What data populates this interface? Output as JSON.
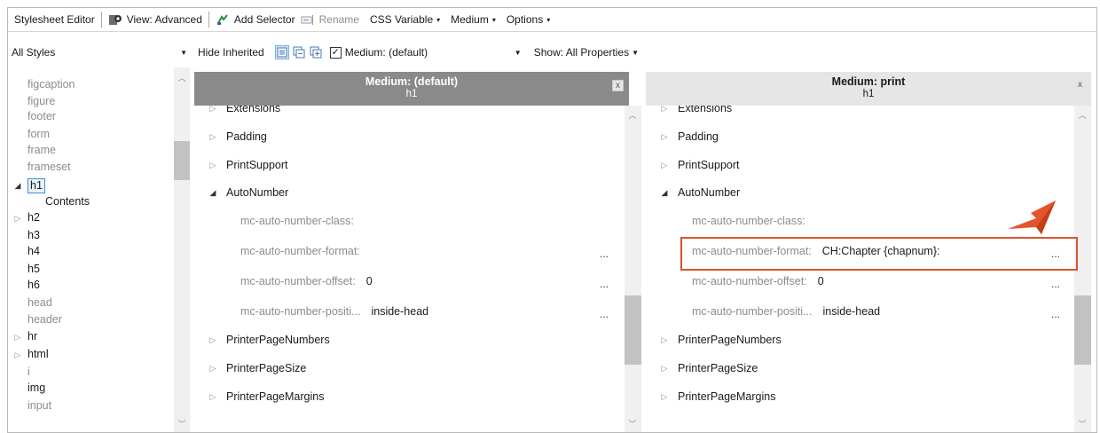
{
  "toolbar": {
    "title": "Stylesheet Editor",
    "view_label": "View: Advanced",
    "add_selector": "Add Selector",
    "rename": "Rename",
    "css_variable": "CSS Variable",
    "medium": "Medium",
    "options": "Options"
  },
  "filters": {
    "styles_combo": "All Styles",
    "hide_inherited": "Hide Inherited",
    "medium_check": "Medium: (default)",
    "show": "Show: All Properties"
  },
  "tree": {
    "items": [
      {
        "label": "figcaption",
        "expander": "",
        "state": "inherited"
      },
      {
        "label": "figure",
        "expander": "",
        "state": "inherited"
      },
      {
        "label": "footer",
        "expander": "",
        "state": "inherited"
      },
      {
        "label": "form",
        "expander": "",
        "state": "inherited"
      },
      {
        "label": "frame",
        "expander": "",
        "state": "inherited"
      },
      {
        "label": "frameset",
        "expander": "",
        "state": "inherited"
      },
      {
        "label": "h1",
        "expander": "◢",
        "state": "selected"
      },
      {
        "label": "Contents",
        "expander": "",
        "state": "child"
      },
      {
        "label": "h2",
        "expander": "▷",
        "state": "defined"
      },
      {
        "label": "h3",
        "expander": "",
        "state": "defined"
      },
      {
        "label": "h4",
        "expander": "",
        "state": "defined"
      },
      {
        "label": "h5",
        "expander": "",
        "state": "defined"
      },
      {
        "label": "h6",
        "expander": "",
        "state": "defined"
      },
      {
        "label": "head",
        "expander": "",
        "state": "inherited"
      },
      {
        "label": "header",
        "expander": "",
        "state": "inherited"
      },
      {
        "label": "hr",
        "expander": "▷",
        "state": "defined"
      },
      {
        "label": "html",
        "expander": "▷",
        "state": "defined"
      },
      {
        "label": "i",
        "expander": "",
        "state": "inherited"
      },
      {
        "label": "img",
        "expander": "",
        "state": "defined"
      },
      {
        "label": "input",
        "expander": "",
        "state": "inherited"
      }
    ]
  },
  "panes": [
    {
      "title": "Medium: (default)",
      "selector": "h1",
      "close": "x",
      "groups_top": [
        "Extensions",
        "Padding",
        "PrintSupport"
      ],
      "open_group": "AutoNumber",
      "props": [
        {
          "name": "mc-auto-number-class:",
          "value": "",
          "more": ""
        },
        {
          "name": "mc-auto-number-format:",
          "value": "",
          "more": "..."
        },
        {
          "name": "mc-auto-number-offset:",
          "value": "0",
          "more": "..."
        },
        {
          "name": "mc-auto-number-positi...",
          "value": "inside-head",
          "more": "..."
        }
      ],
      "groups_bottom": [
        "PrinterPageNumbers",
        "PrinterPageSize",
        "PrinterPageMargins"
      ]
    },
    {
      "title": "Medium: print",
      "selector": "h1",
      "close": "x",
      "groups_top": [
        "Extensions",
        "Padding",
        "PrintSupport"
      ],
      "open_group": "AutoNumber",
      "props": [
        {
          "name": "mc-auto-number-class:",
          "value": "",
          "more": ""
        },
        {
          "name": "mc-auto-number-format:",
          "value": "CH:Chapter {chapnum}:",
          "more": "..."
        },
        {
          "name": "mc-auto-number-offset:",
          "value": "0",
          "more": "..."
        },
        {
          "name": "mc-auto-number-positi...",
          "value": "inside-head",
          "more": "..."
        }
      ],
      "groups_bottom": [
        "PrinterPageNumbers",
        "PrinterPageSize",
        "PrinterPageMargins"
      ]
    }
  ],
  "colors": {
    "active_header": "#8a8a8a",
    "inactive_header": "#e6e6e6",
    "highlight": "#d9542d",
    "accent": "#3c8dde"
  },
  "icons": {
    "view": "eye-icon",
    "add_selector": "add-selector-icon",
    "rename": "rename-icon",
    "collapse_tree": "collapse-icon",
    "expand_tree": "expand-icon",
    "copy": "copy-icon",
    "callout": "arrow-pointer-icon"
  }
}
